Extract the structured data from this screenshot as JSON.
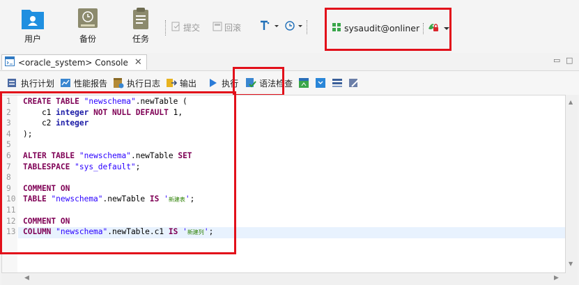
{
  "toolbar": {
    "users_label": "用户",
    "backup_label": "备份",
    "tasks_label": "任务",
    "commit_label": "提交",
    "rollback_label": "回滚",
    "connection_label": "sysaudit@onliner"
  },
  "tab": {
    "title": "<oracle_system> Console"
  },
  "console_toolbar": {
    "plan_label": "执行计划",
    "perf_label": "性能报告",
    "log_label": "执行日志",
    "output_label": "输出",
    "execute_label": "执行",
    "syntax_label": "语法检查"
  },
  "editor": {
    "line_numbers": [
      "1",
      "2",
      "3",
      "4",
      "5",
      "6",
      "7",
      "8",
      "9",
      "10",
      "11",
      "12",
      "13"
    ],
    "lines": [
      "CREATE TABLE \"newschema\".newTable (",
      "    c1 integer NOT NULL DEFAULT 1,",
      "    c2 integer",
      ");",
      "",
      "ALTER TABLE \"newschema\".newTable SET",
      "TABLESPACE \"sys_default\";",
      "",
      "COMMENT ON",
      "TABLE \"newschema\".newTable IS '新建表';",
      "",
      "COMMENT ON",
      "COLUMN \"newschema\".newTable.c1 IS '新建列';"
    ]
  },
  "colors": {
    "highlight_box": "#e2101a",
    "keyword": "#7f0055",
    "type": "#1a1aa6",
    "string": "#2a00ff"
  }
}
